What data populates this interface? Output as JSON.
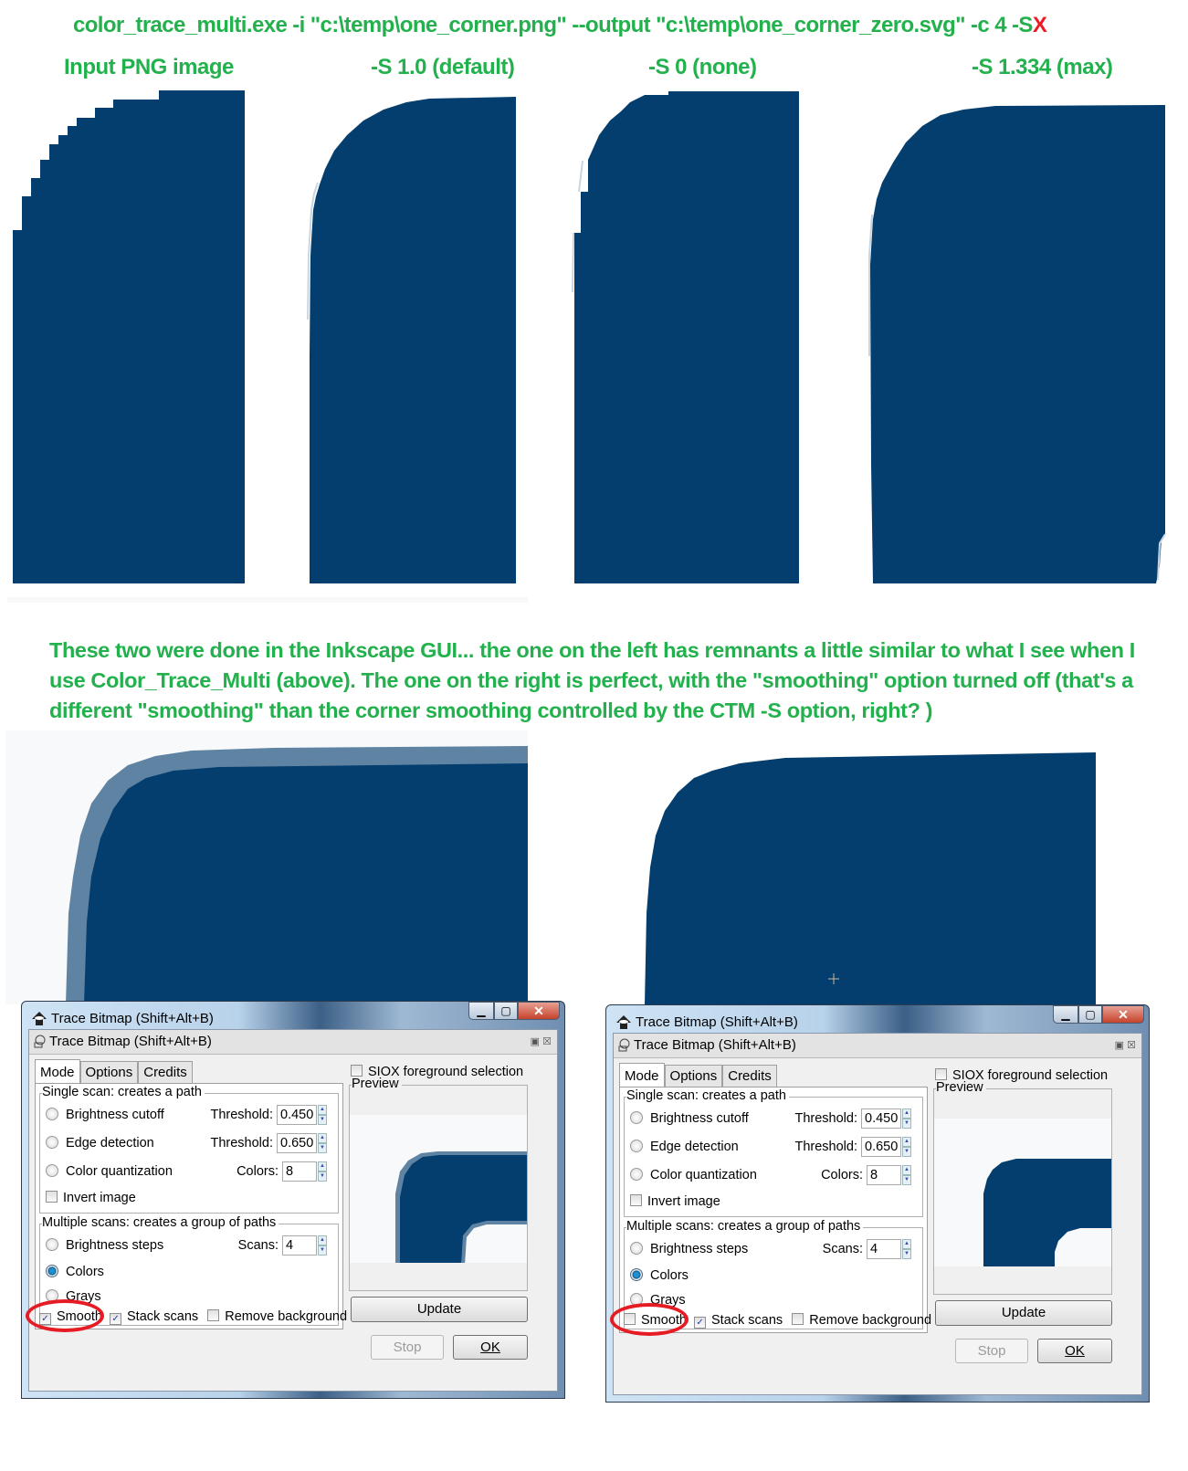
{
  "header": {
    "command": "color_trace_multi.exe -i \"c:\\temp\\one_corner.png\" --output \"c:\\temp\\one_corner_zero.svg\" -c 4 -S",
    "command_suffix": "X"
  },
  "comparison_labels": [
    "Input PNG image",
    "-S 1.0 (default)",
    "-S 0 (none)",
    "-S 1.334 (max)"
  ],
  "note": "These two were done in the Inkscape GUI... the one on the left has remnants a little similar to what I see when I use Color_Trace_Multi (above). The one on the right is perfect, with the \"smoothing\" option turned off (that's a different \"smoothing\" than the corner smoothing controlled by the CTM -S option, right?  )",
  "colors": {
    "shape": "#043e6e",
    "shape_halo": "#5f83a3",
    "green_text": "#22b14c",
    "red_mark": "#e51c23"
  },
  "dialogs": [
    {
      "window_title": "Trace Bitmap (Shift+Alt+B)",
      "panel_title": "Trace Bitmap (Shift+Alt+B)",
      "tabs": [
        "Mode",
        "Options",
        "Credits"
      ],
      "active_tab": "Mode",
      "single_scan_title": "Single scan: creates a path",
      "brightness_cutoff": "Brightness cutoff",
      "edge_detection": "Edge detection",
      "color_quantization": "Color quantization",
      "threshold_label": "Threshold:",
      "brightness_threshold": "0.450",
      "edge_threshold": "0.650",
      "colors_label": "Colors:",
      "colors_value": "8",
      "invert_image": "Invert image",
      "multi_scan_title": "Multiple scans: creates a group of paths",
      "brightness_steps": "Brightness steps",
      "scans_label": "Scans:",
      "scans_value": "4",
      "colors_option": "Colors",
      "grays_option": "Grays",
      "smooth": "Smooth",
      "smooth_checked": true,
      "stack_scans": "Stack scans",
      "stack_checked": true,
      "remove_background": "Remove background",
      "remove_bg_checked": false,
      "siox": "SIOX foreground selection",
      "preview": "Preview",
      "update": "Update",
      "stop": "Stop",
      "ok": "OK"
    },
    {
      "window_title": "Trace Bitmap (Shift+Alt+B)",
      "panel_title": "Trace Bitmap (Shift+Alt+B)",
      "tabs": [
        "Mode",
        "Options",
        "Credits"
      ],
      "active_tab": "Mode",
      "single_scan_title": "Single scan: creates a path",
      "brightness_cutoff": "Brightness cutoff",
      "edge_detection": "Edge detection",
      "color_quantization": "Color quantization",
      "threshold_label": "Threshold:",
      "brightness_threshold": "0.450",
      "edge_threshold": "0.650",
      "colors_label": "Colors:",
      "colors_value": "8",
      "invert_image": "Invert image",
      "multi_scan_title": "Multiple scans: creates a group of paths",
      "brightness_steps": "Brightness steps",
      "scans_label": "Scans:",
      "scans_value": "4",
      "colors_option": "Colors",
      "grays_option": "Grays",
      "smooth": "Smooth",
      "smooth_checked": false,
      "stack_scans": "Stack scans",
      "stack_checked": true,
      "remove_background": "Remove background",
      "remove_bg_checked": false,
      "siox": "SIOX foreground selection",
      "preview": "Preview",
      "update": "Update",
      "stop": "Stop",
      "ok": "OK"
    }
  ]
}
